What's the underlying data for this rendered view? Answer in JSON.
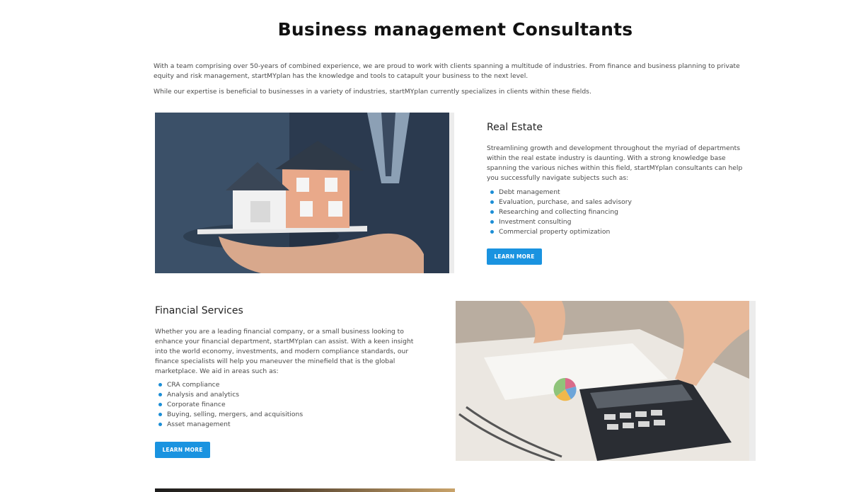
{
  "page_title": "Business management Consultants",
  "intro": {
    "p1": "With a team comprising over 50-years of combined experience, we are proud to work with clients spanning a multitude of industries. From finance and business planning to private equity and risk management, startMYplan has the knowledge and tools to catapult your business to the next level.",
    "p2": "While our expertise is beneficial to businesses in a variety of industries, startMYplan currently specializes in clients within these fields."
  },
  "real_estate": {
    "title": "Real Estate",
    "text": "Streamlining growth and development throughout the myriad of departments within the real estate industry is daunting. With a strong knowledge base spanning the various niches within this field, startMYplan consultants can help you successfully navigate subjects such as:",
    "bullets": [
      "Debt management",
      "Evaluation, purchase, and sales advisory",
      "Researching and collecting financing",
      "Investment consulting",
      "Commercial property optimization"
    ],
    "button": "LEARN MORE"
  },
  "financial": {
    "title": "Financial Services",
    "text": "Whether you are a leading financial company, or a small business looking to enhance your financial department, startMYplan can assist. With a keen insight into the world economy, investments, and modern compliance standards, our finance specialists will help you maneuver the minefield that is the global marketplace. We aid in areas such as:",
    "bullets": [
      "CRA compliance",
      "Analysis and analytics",
      "Corporate finance",
      "Buying, selling, mergers, and acquisitions",
      "Asset management"
    ],
    "button": "LEARN MORE"
  },
  "colors": {
    "accent": "#1a93e0",
    "bullet": "#1c8ed6",
    "title": "#111111",
    "body": "#4a4a4a"
  }
}
